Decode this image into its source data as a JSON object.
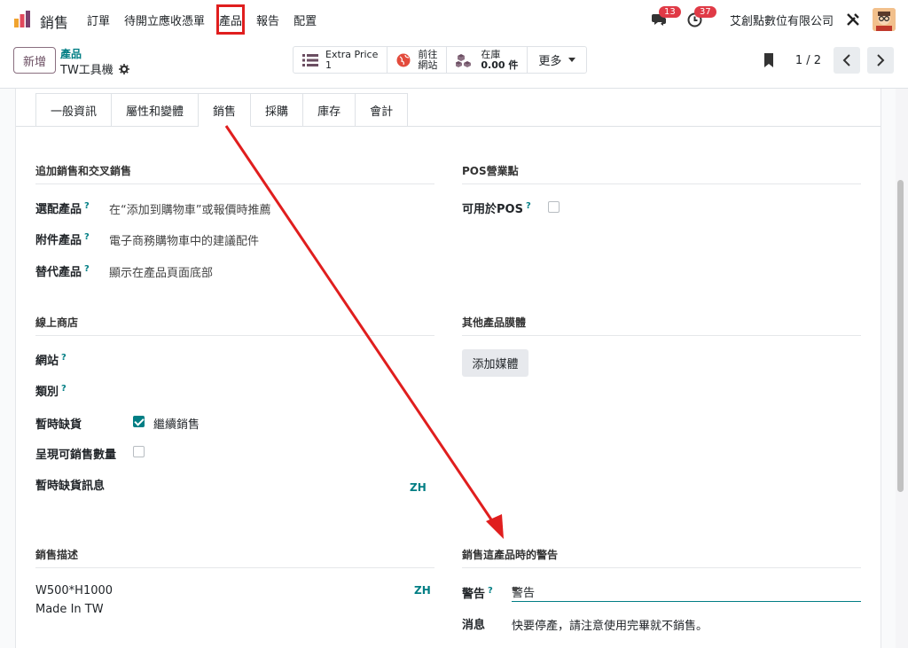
{
  "navbar": {
    "app_name": "銷售",
    "menu": [
      "訂單",
      "待開立應收憑單",
      "產品",
      "報告",
      "配置"
    ],
    "messages_count": "13",
    "activities_count": "37",
    "company": "艾創點數位有限公司"
  },
  "control": {
    "new_label": "新增",
    "breadcrumb_parent": "產品",
    "breadcrumb_current": "TW工具機",
    "smart_buttons": [
      {
        "line1": "Extra Price",
        "line2": "1"
      },
      {
        "line1": "前往",
        "line2": "網站"
      },
      {
        "line1": "在庫",
        "line2": "0.00 件"
      }
    ],
    "more_label": "更多",
    "pager": "1 / 2"
  },
  "tabs": [
    "一般資訊",
    "屬性和變體",
    "銷售",
    "採購",
    "庫存",
    "會計"
  ],
  "sections": {
    "upsell": {
      "title": "追加銷售和交叉銷售",
      "optional_label": "選配產品",
      "optional_value": "在“添加到購物車”或報價時推薦",
      "accessory_label": "附件產品",
      "accessory_value": "電子商務購物車中的建議配件",
      "alternative_label": "替代產品",
      "alternative_value": "顯示在產品頁面底部"
    },
    "pos": {
      "title": "POS營業點",
      "available_label": "可用於POS"
    },
    "shop": {
      "title": "線上商店",
      "website_label": "網站",
      "category_label": "類別",
      "out_of_stock_label": "暫時缺貨",
      "continue_selling_label": "繼續銷售",
      "show_qty_label": "呈現可銷售數量",
      "oos_message_label": "暫時缺貨訊息",
      "lang": "ZH"
    },
    "media": {
      "title": "其他產品膜體",
      "add_media_label": "添加媒體"
    },
    "description": {
      "title": "銷售描述",
      "line1": "W500*H1000",
      "line2": "Made In TW",
      "lang": "ZH"
    },
    "warning": {
      "title": "銷售這產品時的警告",
      "warning_label": "警告",
      "warning_value": "警告",
      "message_label": "消息",
      "message_value": "快要停產，請注意使用完畢就不銷售。"
    }
  },
  "colors": {
    "accent": "#017e84",
    "brand": "#714b67",
    "badge": "#e03a46",
    "annotation": "#e01e1e"
  }
}
